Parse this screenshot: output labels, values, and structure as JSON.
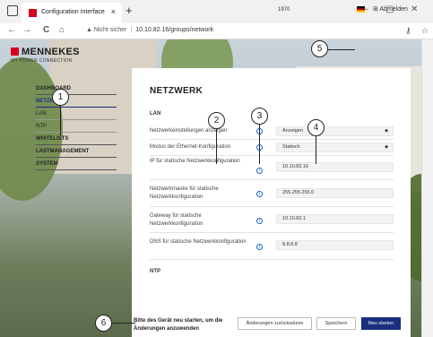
{
  "browser": {
    "tab_title": "Configuration Interface",
    "tab_close": "×",
    "new_tab": "+",
    "win_min": "–",
    "win_max": "▢",
    "win_close": "✕",
    "back": "←",
    "forward": "→",
    "reload": "C",
    "home": "⌂",
    "security_warning": "▲ Nicht sicher",
    "url": "10.10.82.16/groups/network"
  },
  "header": {
    "brand_name": "MENNEKES",
    "brand_slogan": "MY POWER CONNECTION",
    "charger_id": "1970",
    "language": "DE",
    "logout_label": "⊞ Abmelden"
  },
  "sidebar": {
    "items": [
      {
        "label": "DASHBOARD"
      },
      {
        "label": "NETZWERK"
      },
      {
        "label": "LAN"
      },
      {
        "label": "NTP"
      },
      {
        "label": "WHITELISTS"
      },
      {
        "label": "LASTMANAGEMENT"
      },
      {
        "label": "SYSTEM"
      }
    ]
  },
  "main": {
    "title": "NETZWERK",
    "section_lan": "LAN",
    "section_ntp": "NTP",
    "rows": [
      {
        "label": "Netzwerkeinstellungen anzeigen",
        "value": "Anzeigen"
      },
      {
        "label": "Modus der Ethernet-Konfiguration",
        "value": "Statisch"
      },
      {
        "label": "IP für statische Netzwerkkonfiguration",
        "value": "10.10.82.16"
      },
      {
        "label": "Netzwerkmaske für statische Netzwerkkonfiguration",
        "value": "255.255.255.0"
      },
      {
        "label": "Gateway für statische Netzwerkkonfiguration",
        "value": "10.10.82.1"
      },
      {
        "label": "DNS für statische Netzwerkkonfiguration",
        "value": "8.8.8.8"
      }
    ]
  },
  "footer": {
    "message": "Bitte des Gerät neu starten, um die Änderungen anzuwenden",
    "reset_label": "Änderungen zurücksetzen",
    "save_label": "Speichern",
    "restart_label": "Neu starten"
  },
  "callouts": [
    "1",
    "2",
    "3",
    "4",
    "5",
    "6"
  ],
  "colors": {
    "brand_red": "#d6001c",
    "accent_blue": "#1a2f80",
    "info_blue": "#1a66c8"
  }
}
